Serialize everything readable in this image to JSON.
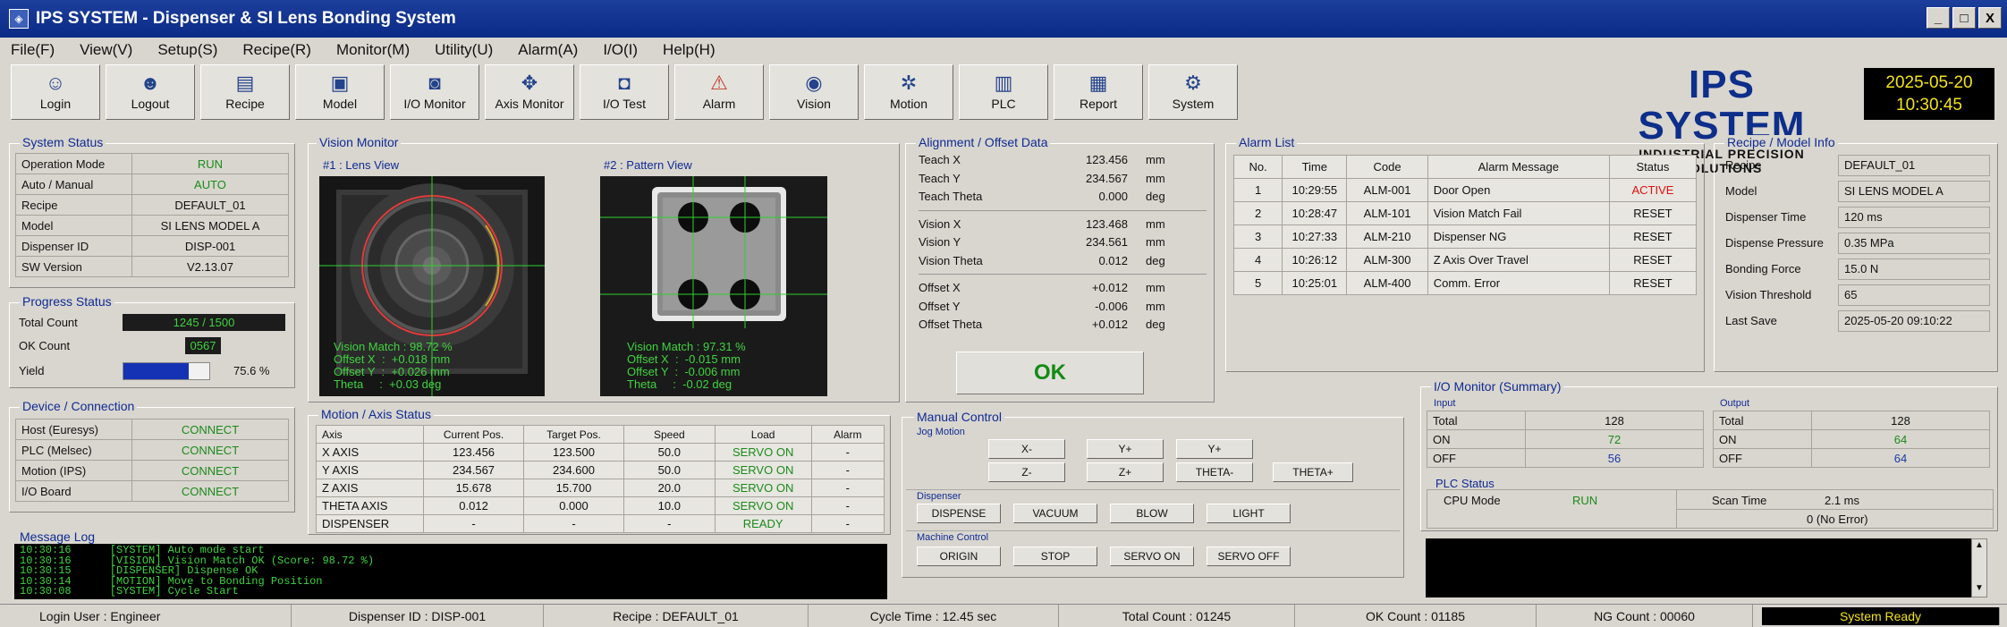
{
  "window": {
    "title": "IPS SYSTEM - Dispenser & SI Lens Bonding System",
    "controls": [
      "_",
      "□",
      "X"
    ]
  },
  "menu": [
    "File(F)",
    "View(V)",
    "Setup(S)",
    "Recipe(R)",
    "Monitor(M)",
    "Utility(U)",
    "Alarm(A)",
    "I/O(I)",
    "Help(H)"
  ],
  "toolbar": [
    {
      "label": "Login",
      "icon": "user-icon"
    },
    {
      "label": "Logout",
      "icon": "user-logout-icon"
    },
    {
      "label": "Recipe",
      "icon": "recipe-icon"
    },
    {
      "label": "Model",
      "icon": "model-icon"
    },
    {
      "label": "I/O Monitor",
      "icon": "io-monitor-icon"
    },
    {
      "label": "Axis Monitor",
      "icon": "axis-icon"
    },
    {
      "label": "I/O Test",
      "icon": "io-test-icon"
    },
    {
      "label": "Alarm",
      "icon": "alarm-icon"
    },
    {
      "label": "Vision",
      "icon": "vision-icon"
    },
    {
      "label": "Motion",
      "icon": "motion-icon"
    },
    {
      "label": "PLC",
      "icon": "plc-icon"
    },
    {
      "label": "Report",
      "icon": "report-icon"
    },
    {
      "label": "System",
      "icon": "system-icon"
    }
  ],
  "brand": {
    "name": "IPS SYSTEM",
    "tagline": "INDUSTRIAL PRECISION SOLUTIONS"
  },
  "clock": {
    "date": "2025-05-20",
    "time": "10:30:45"
  },
  "system_status": {
    "title": "System Status",
    "rows": [
      {
        "label": "Operation Mode",
        "value": "RUN"
      },
      {
        "label": "Auto / Manual",
        "value": "AUTO"
      },
      {
        "label": "Recipe",
        "value": "DEFAULT_01"
      },
      {
        "label": "Model",
        "value": "SI LENS MODEL A"
      },
      {
        "label": "Dispenser ID",
        "value": "DISP-001"
      },
      {
        "label": "SW Version",
        "value": "V2.13.07"
      }
    ]
  },
  "progress": {
    "title": "Progress Status",
    "total_label": "Total Count",
    "total_value": "1245 / 1500",
    "ok_label": "OK Count",
    "ok_value": "0567",
    "yield_label": "Yield",
    "yield_value": "75.6 %",
    "yield_fraction": 0.756
  },
  "device": {
    "title": "Device / Connection",
    "rows": [
      {
        "label": "Host (Euresys)",
        "value": "CONNECT"
      },
      {
        "label": "PLC (Melsec)",
        "value": "CONNECT"
      },
      {
        "label": "Motion (IPS)",
        "value": "CONNECT"
      },
      {
        "label": "I/O Board",
        "value": "CONNECT"
      }
    ]
  },
  "vision": {
    "title": "Vision Monitor",
    "view1": {
      "label": "#1 : Lens View",
      "lines": "Vision Match : 98.72 %\nOffset X  :  +0.018 mm\nOffset Y  :  +0.026 mm\nTheta     :  +0.03 deg"
    },
    "view2": {
      "label": "#2 : Pattern View",
      "lines": "Vision Match : 97.31 %\nOffset X  :  -0.015 mm\nOffset Y  :  -0.006 mm\nTheta     :  -0.02 deg"
    }
  },
  "alignment": {
    "title": "Alignment / Offset Data",
    "groups": [
      [
        {
          "label": "Teach X",
          "value": "123.456",
          "unit": "mm"
        },
        {
          "label": "Teach Y",
          "value": "234.567",
          "unit": "mm"
        },
        {
          "label": "Teach Theta",
          "value": "0.000",
          "unit": "deg"
        }
      ],
      [
        {
          "label": "Vision X",
          "value": "123.468",
          "unit": "mm"
        },
        {
          "label": "Vision Y",
          "value": "234.561",
          "unit": "mm"
        },
        {
          "label": "Vision Theta",
          "value": "0.012",
          "unit": "deg"
        }
      ],
      [
        {
          "label": "Offset X",
          "value": "+0.012",
          "unit": "mm"
        },
        {
          "label": "Offset Y",
          "value": "-0.006",
          "unit": "mm"
        },
        {
          "label": "Offset Theta",
          "value": "+0.012",
          "unit": "deg"
        }
      ]
    ],
    "result": "OK"
  },
  "alarm_list": {
    "title": "Alarm List",
    "headers": [
      "No.",
      "Time",
      "Code",
      "Alarm Message",
      "Status"
    ],
    "rows": [
      [
        "1",
        "10:29:55",
        "ALM-001",
        "Door Open",
        "ACTIVE"
      ],
      [
        "2",
        "10:28:47",
        "ALM-101",
        "Vision Match Fail",
        "RESET"
      ],
      [
        "3",
        "10:27:33",
        "ALM-210",
        "Dispenser NG",
        "RESET"
      ],
      [
        "4",
        "10:26:12",
        "ALM-300",
        "Z Axis Over Travel",
        "RESET"
      ],
      [
        "5",
        "10:25:01",
        "ALM-400",
        "Comm. Error",
        "RESET"
      ]
    ]
  },
  "recipe_info": {
    "title": "Recipe / Model Info",
    "rows": [
      {
        "label": "Recipe",
        "value": "DEFAULT_01"
      },
      {
        "label": "Model",
        "value": "SI LENS MODEL A"
      },
      {
        "label": "Dispenser Time",
        "value": "120 ms"
      },
      {
        "label": "Dispense Pressure",
        "value": "0.35 MPa"
      },
      {
        "label": "Bonding Force",
        "value": "15.0 N"
      },
      {
        "label": "Vision Threshold",
        "value": "65"
      },
      {
        "label": "Last Save",
        "value": "2025-05-20 09:10:22"
      }
    ]
  },
  "motion": {
    "title": "Motion / Axis Status",
    "headers": [
      "Axis",
      "Current Pos.",
      "Target Pos.",
      "Speed",
      "Load",
      "Alarm"
    ],
    "rows": [
      [
        "X AXIS",
        "123.456",
        "123.500",
        "50.0",
        "SERVO ON",
        "-"
      ],
      [
        "Y AXIS",
        "234.567",
        "234.600",
        "50.0",
        "SERVO ON",
        "-"
      ],
      [
        "Z AXIS",
        "15.678",
        "15.700",
        "20.0",
        "SERVO ON",
        "-"
      ],
      [
        "THETA AXIS",
        "0.012",
        "0.000",
        "10.0",
        "SERVO ON",
        "-"
      ],
      [
        "DISPENSER",
        "-",
        "-",
        "-",
        "READY",
        "-"
      ]
    ]
  },
  "manual": {
    "title": "Manual Control",
    "jog_title": "Jog Motion",
    "jog": [
      "X-",
      "Y+",
      "Y+",
      "Z-",
      "Z+",
      "THETA-",
      "THETA+"
    ],
    "dispenser_title": "Dispenser",
    "dispenser": [
      "DISPENSE",
      "VACUUM",
      "BLOW",
      "LIGHT"
    ],
    "machine_title": "Machine Control",
    "machine": [
      "ORIGIN",
      "STOP",
      "SERVO ON",
      "SERVO OFF"
    ]
  },
  "io": {
    "title": "I/O Monitor (Summary)",
    "input_title": "Input",
    "output_title": "Output",
    "input": [
      {
        "label": "Total",
        "value": "128"
      },
      {
        "label": "ON",
        "value": "72"
      },
      {
        "label": "OFF",
        "value": "56"
      }
    ],
    "output": [
      {
        "label": "Total",
        "value": "128"
      },
      {
        "label": "ON",
        "value": "64"
      },
      {
        "label": "OFF",
        "value": "64"
      }
    ]
  },
  "plc": {
    "title": "PLC Status",
    "cpu_label": "CPU Mode",
    "cpu_value": "RUN",
    "scan_label": "Scan Time",
    "scan_value": "2.1 ms",
    "error_value": "0 (No Error)"
  },
  "message_log": {
    "title": "Message Log",
    "lines": [
      {
        "time": "10:30:16",
        "text": "[SYSTEM] Auto mode start"
      },
      {
        "time": "10:30:16",
        "text": "[VISION] Vision Match OK (Score: 98.72 %)"
      },
      {
        "time": "10:30:15",
        "text": "[DISPENSER] Dispense OK"
      },
      {
        "time": "10:30:14",
        "text": "[MOTION] Move to Bonding Position"
      },
      {
        "time": "10:30:08",
        "text": "[SYSTEM] Cycle Start"
      }
    ]
  },
  "statusbar": {
    "user": "Login User : Engineer",
    "dispenser": "Dispenser ID : DISP-001",
    "recipe": "Recipe : DEFAULT_01",
    "cycle": "Cycle Time :  12.45 sec",
    "total": "Total Count :  01245",
    "ok": "OK Count :  01185",
    "ng": "NG Count :  00060",
    "state": "System Ready"
  }
}
